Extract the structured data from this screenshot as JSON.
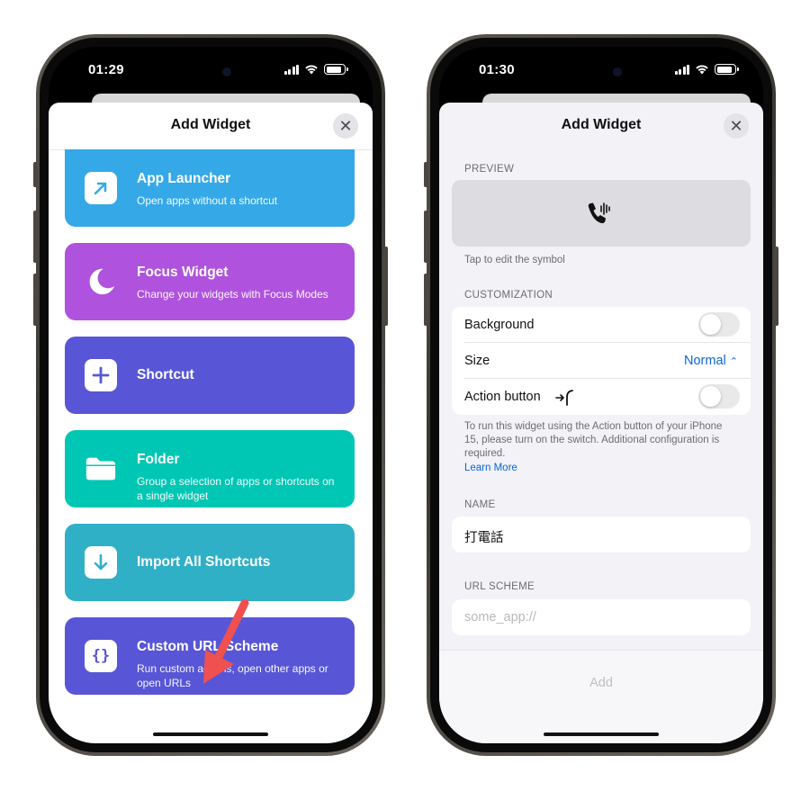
{
  "left_phone": {
    "status": {
      "time": "01:29"
    },
    "sheet": {
      "title": "Add Widget",
      "close_icon": "xmark-icon"
    },
    "cards": [
      {
        "title": "App Launcher",
        "subtitle": "Open apps without a shortcut",
        "icon": "arrow-up-right-icon",
        "color": "#35a9e8"
      },
      {
        "title": "Focus Widget",
        "subtitle": "Change your widgets with Focus Modes",
        "icon": "moon-icon",
        "color": "#af52de"
      },
      {
        "title": "Shortcut",
        "subtitle": "",
        "icon": "plus-icon",
        "color": "#5856d6"
      },
      {
        "title": "Folder",
        "subtitle": "Group a selection of apps or shortcuts on a single widget",
        "icon": "folder-icon",
        "color": "#00c7b3"
      },
      {
        "title": "Import All Shortcuts",
        "subtitle": "",
        "icon": "arrow-down-icon",
        "color": "#30b0c7"
      },
      {
        "title": "Custom URL Scheme",
        "subtitle": "Run custom actions, open other apps or open URLs",
        "icon": "braces-icon",
        "color": "#5856d6"
      }
    ],
    "annotation_arrow_color": "#f0504f"
  },
  "right_phone": {
    "status": {
      "time": "01:30"
    },
    "sheet": {
      "title": "Add Widget",
      "close_icon": "xmark-icon"
    },
    "preview": {
      "section": "PREVIEW",
      "icon": "phone-waveform-icon",
      "hint": "Tap to edit the symbol"
    },
    "customization": {
      "section": "CUSTOMIZATION",
      "background_label": "Background",
      "background_on": false,
      "size_label": "Size",
      "size_value": "Normal",
      "action_label": "Action button",
      "action_on": false,
      "footer": "To run this widget using the Action button of your iPhone 15, please turn on the switch. Additional configuration is required.",
      "learn_more": "Learn More"
    },
    "name": {
      "section": "NAME",
      "value": "打電話"
    },
    "url_scheme": {
      "section": "URL SCHEME",
      "placeholder": "some_app://"
    },
    "add_button": "Add"
  }
}
